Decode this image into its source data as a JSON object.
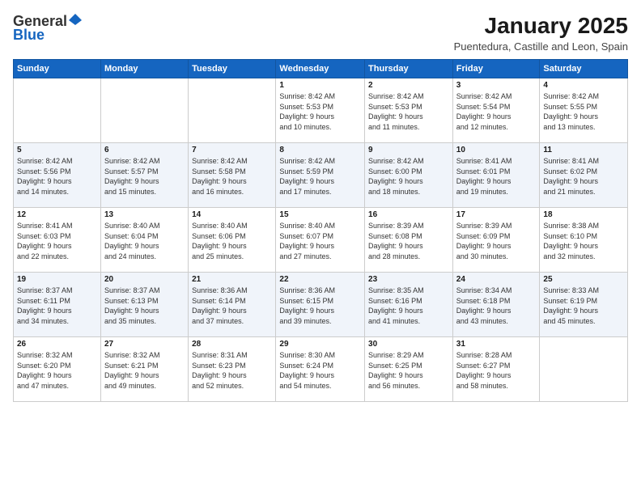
{
  "logo": {
    "line1": "General",
    "line2": "Blue"
  },
  "header": {
    "month": "January 2025",
    "location": "Puentedura, Castille and Leon, Spain"
  },
  "weekdays": [
    "Sunday",
    "Monday",
    "Tuesday",
    "Wednesday",
    "Thursday",
    "Friday",
    "Saturday"
  ],
  "weeks": [
    [
      {
        "day": "",
        "info": ""
      },
      {
        "day": "",
        "info": ""
      },
      {
        "day": "",
        "info": ""
      },
      {
        "day": "1",
        "info": "Sunrise: 8:42 AM\nSunset: 5:53 PM\nDaylight: 9 hours\nand 10 minutes."
      },
      {
        "day": "2",
        "info": "Sunrise: 8:42 AM\nSunset: 5:53 PM\nDaylight: 9 hours\nand 11 minutes."
      },
      {
        "day": "3",
        "info": "Sunrise: 8:42 AM\nSunset: 5:54 PM\nDaylight: 9 hours\nand 12 minutes."
      },
      {
        "day": "4",
        "info": "Sunrise: 8:42 AM\nSunset: 5:55 PM\nDaylight: 9 hours\nand 13 minutes."
      }
    ],
    [
      {
        "day": "5",
        "info": "Sunrise: 8:42 AM\nSunset: 5:56 PM\nDaylight: 9 hours\nand 14 minutes."
      },
      {
        "day": "6",
        "info": "Sunrise: 8:42 AM\nSunset: 5:57 PM\nDaylight: 9 hours\nand 15 minutes."
      },
      {
        "day": "7",
        "info": "Sunrise: 8:42 AM\nSunset: 5:58 PM\nDaylight: 9 hours\nand 16 minutes."
      },
      {
        "day": "8",
        "info": "Sunrise: 8:42 AM\nSunset: 5:59 PM\nDaylight: 9 hours\nand 17 minutes."
      },
      {
        "day": "9",
        "info": "Sunrise: 8:42 AM\nSunset: 6:00 PM\nDaylight: 9 hours\nand 18 minutes."
      },
      {
        "day": "10",
        "info": "Sunrise: 8:41 AM\nSunset: 6:01 PM\nDaylight: 9 hours\nand 19 minutes."
      },
      {
        "day": "11",
        "info": "Sunrise: 8:41 AM\nSunset: 6:02 PM\nDaylight: 9 hours\nand 21 minutes."
      }
    ],
    [
      {
        "day": "12",
        "info": "Sunrise: 8:41 AM\nSunset: 6:03 PM\nDaylight: 9 hours\nand 22 minutes."
      },
      {
        "day": "13",
        "info": "Sunrise: 8:40 AM\nSunset: 6:04 PM\nDaylight: 9 hours\nand 24 minutes."
      },
      {
        "day": "14",
        "info": "Sunrise: 8:40 AM\nSunset: 6:06 PM\nDaylight: 9 hours\nand 25 minutes."
      },
      {
        "day": "15",
        "info": "Sunrise: 8:40 AM\nSunset: 6:07 PM\nDaylight: 9 hours\nand 27 minutes."
      },
      {
        "day": "16",
        "info": "Sunrise: 8:39 AM\nSunset: 6:08 PM\nDaylight: 9 hours\nand 28 minutes."
      },
      {
        "day": "17",
        "info": "Sunrise: 8:39 AM\nSunset: 6:09 PM\nDaylight: 9 hours\nand 30 minutes."
      },
      {
        "day": "18",
        "info": "Sunrise: 8:38 AM\nSunset: 6:10 PM\nDaylight: 9 hours\nand 32 minutes."
      }
    ],
    [
      {
        "day": "19",
        "info": "Sunrise: 8:37 AM\nSunset: 6:11 PM\nDaylight: 9 hours\nand 34 minutes."
      },
      {
        "day": "20",
        "info": "Sunrise: 8:37 AM\nSunset: 6:13 PM\nDaylight: 9 hours\nand 35 minutes."
      },
      {
        "day": "21",
        "info": "Sunrise: 8:36 AM\nSunset: 6:14 PM\nDaylight: 9 hours\nand 37 minutes."
      },
      {
        "day": "22",
        "info": "Sunrise: 8:36 AM\nSunset: 6:15 PM\nDaylight: 9 hours\nand 39 minutes."
      },
      {
        "day": "23",
        "info": "Sunrise: 8:35 AM\nSunset: 6:16 PM\nDaylight: 9 hours\nand 41 minutes."
      },
      {
        "day": "24",
        "info": "Sunrise: 8:34 AM\nSunset: 6:18 PM\nDaylight: 9 hours\nand 43 minutes."
      },
      {
        "day": "25",
        "info": "Sunrise: 8:33 AM\nSunset: 6:19 PM\nDaylight: 9 hours\nand 45 minutes."
      }
    ],
    [
      {
        "day": "26",
        "info": "Sunrise: 8:32 AM\nSunset: 6:20 PM\nDaylight: 9 hours\nand 47 minutes."
      },
      {
        "day": "27",
        "info": "Sunrise: 8:32 AM\nSunset: 6:21 PM\nDaylight: 9 hours\nand 49 minutes."
      },
      {
        "day": "28",
        "info": "Sunrise: 8:31 AM\nSunset: 6:23 PM\nDaylight: 9 hours\nand 52 minutes."
      },
      {
        "day": "29",
        "info": "Sunrise: 8:30 AM\nSunset: 6:24 PM\nDaylight: 9 hours\nand 54 minutes."
      },
      {
        "day": "30",
        "info": "Sunrise: 8:29 AM\nSunset: 6:25 PM\nDaylight: 9 hours\nand 56 minutes."
      },
      {
        "day": "31",
        "info": "Sunrise: 8:28 AM\nSunset: 6:27 PM\nDaylight: 9 hours\nand 58 minutes."
      },
      {
        "day": "",
        "info": ""
      }
    ]
  ]
}
